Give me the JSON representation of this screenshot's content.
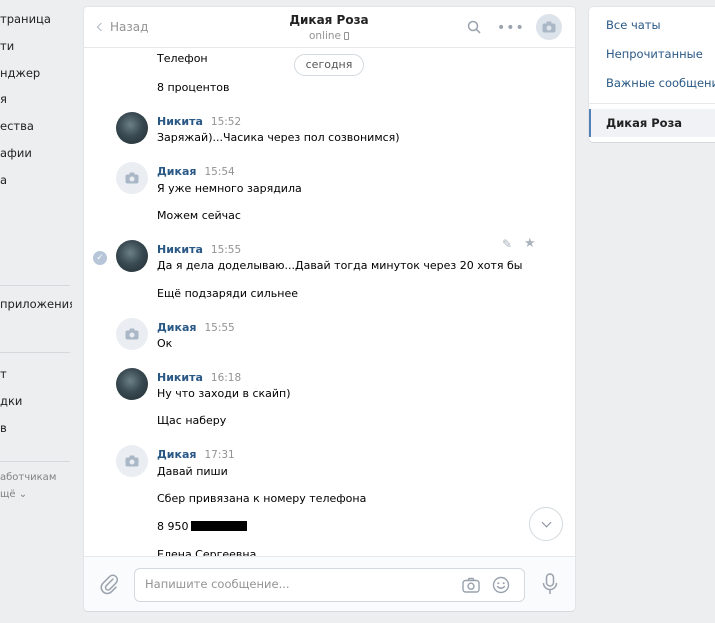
{
  "left_nav": {
    "items": [
      "траница",
      "ти",
      "нджер",
      "я",
      "ества",
      "афии",
      "а"
    ],
    "apps": "приложения",
    "lower": [
      "т",
      "дки",
      "в"
    ],
    "footer": [
      "аботчикам",
      "щё ⌄"
    ]
  },
  "header": {
    "back_label": "Назад",
    "peer_name": "Дикая Роза",
    "peer_status": "online"
  },
  "date_divider": "сегодня",
  "top_text": [
    "Телефон",
    "8 процентов"
  ],
  "messages": [
    {
      "author": "Никита",
      "time": "15:52",
      "lines": [
        "Заряжай)...Часика через пол созвонимся)"
      ]
    },
    {
      "author": "Дикая",
      "time": "15:54",
      "lines": [
        "Я уже немного зарядила",
        "Можем сейчас"
      ]
    },
    {
      "author": "Никита",
      "time": "15:55",
      "lines": [
        "Да я дела доделываю...Давай тогда минуток через 20 хотя бы",
        "Ещё подзаряди сильнее"
      ]
    },
    {
      "author": "Дикая",
      "time": "15:55",
      "lines": [
        "Ок"
      ]
    },
    {
      "author": "Никита",
      "time": "16:18",
      "lines": [
        "Ну что заходи в скайп)",
        "Щас наберу"
      ]
    },
    {
      "author": "Дикая",
      "time": "17:31",
      "lines": [
        "Давай пиши",
        "Сбер привязана к номеру телефона",
        "8 950",
        "Елена Сергеевна"
      ]
    }
  ],
  "composer": {
    "placeholder": "Напишите сообщение..."
  },
  "right_nav": {
    "items": [
      "Все чаты",
      "Непрочитанные",
      "Важные сообщения"
    ],
    "active": "Дикая Роза"
  },
  "colors": {
    "link": "#2a5885",
    "background": "#edeef0",
    "accent": "#5181b8"
  }
}
